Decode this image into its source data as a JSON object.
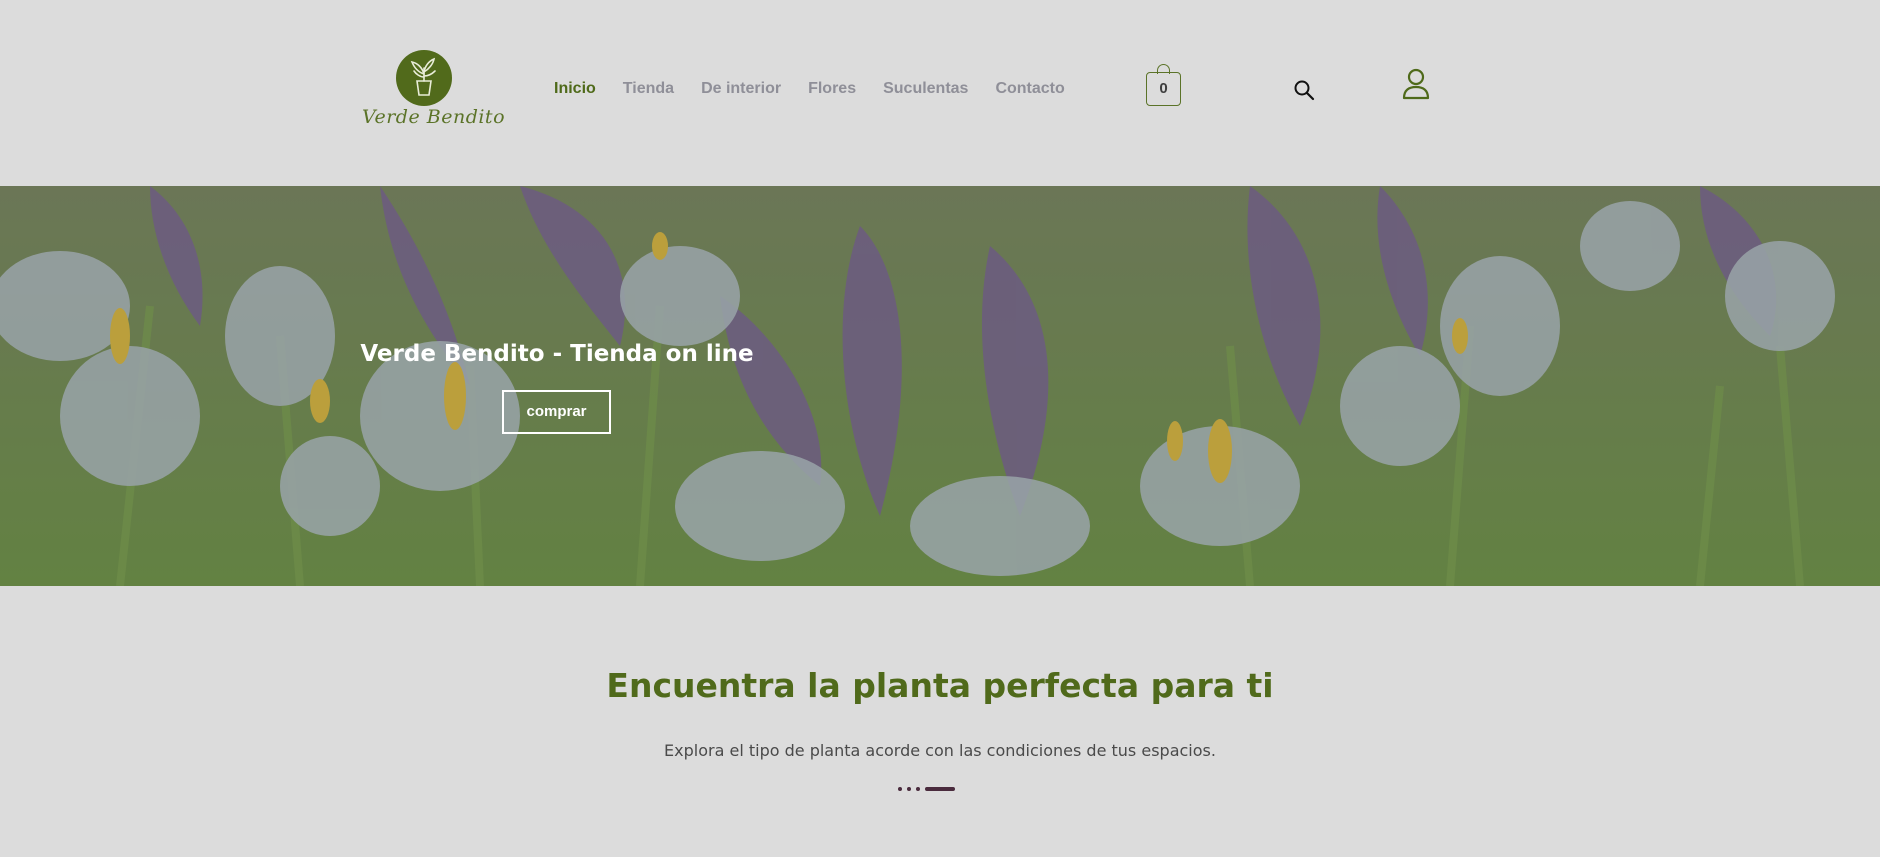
{
  "brand": {
    "name": "Verde Bendito",
    "accent_color": "#516a1b"
  },
  "nav": {
    "items": [
      {
        "label": "Inicio",
        "active": true
      },
      {
        "label": "Tienda",
        "active": false
      },
      {
        "label": "De interior",
        "active": false
      },
      {
        "label": "Flores",
        "active": false
      },
      {
        "label": "Suculentas",
        "active": false
      },
      {
        "label": "Contacto",
        "active": false
      }
    ]
  },
  "header": {
    "cart_count": "0",
    "cart_icon": "shopping-bag-icon",
    "search_icon": "search-icon",
    "user_icon": "user-icon"
  },
  "hero": {
    "title": "Verde Bendito - Tienda on line",
    "button_label": "comprar",
    "background": "purple-iris-flowers"
  },
  "section": {
    "title": "Encuentra la planta perfecta para ti",
    "subtitle": "Explora el tipo de planta acorde con las condiciones de tus espacios.",
    "divider_color": "#4a2b3d"
  }
}
